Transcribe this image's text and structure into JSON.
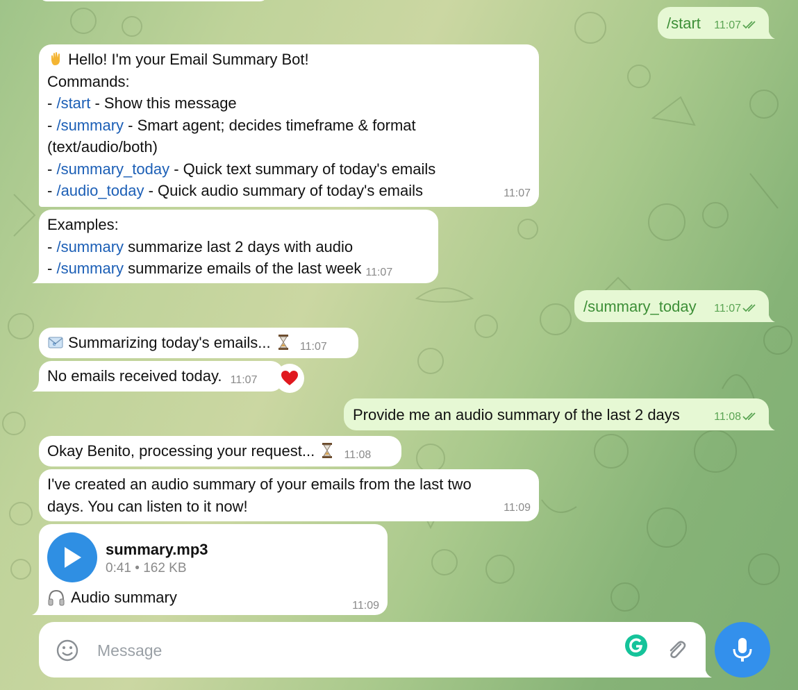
{
  "chat": {
    "messages": [
      {
        "id": "m1",
        "dir": "out",
        "text": "/start",
        "time": "11:07"
      },
      {
        "id": "m2",
        "dir": "in",
        "lines": [
          {
            "prefix": "",
            "emoji": "waving-hand",
            "text": "Hello! I'm your Email Summary Bot!"
          },
          {
            "prefix": "",
            "text": "Commands:"
          },
          {
            "prefix": "- ",
            "cmd": "/start",
            "text": " - Show this message"
          },
          {
            "prefix": "- ",
            "cmd": "/summary",
            "text": " - Smart agent; decides timeframe & format"
          },
          {
            "prefix": "",
            "text": "(text/audio/both)"
          },
          {
            "prefix": "- ",
            "cmd": "/summary_today",
            "text": " - Quick text summary of today's emails"
          },
          {
            "prefix": "- ",
            "cmd": "/audio_today",
            "text": " - Quick audio summary of today's emails"
          }
        ],
        "time": "11:07"
      },
      {
        "id": "m3",
        "dir": "in",
        "lines": [
          {
            "prefix": "",
            "text": "Examples:"
          },
          {
            "prefix": "- ",
            "cmd": "/summary",
            "text": " summarize last 2 days with audio"
          },
          {
            "prefix": "- ",
            "cmd": "/summary",
            "text": " summarize emails of the last week"
          }
        ],
        "time": "11:07"
      },
      {
        "id": "m4",
        "dir": "out",
        "text": "/summary_today",
        "time": "11:07"
      },
      {
        "id": "m5",
        "dir": "in",
        "emoji_start": "envelope",
        "text": "Summarizing today's emails...",
        "emoji_end": "hourglass",
        "time": "11:07"
      },
      {
        "id": "m6",
        "dir": "in",
        "text": "No emails received today.",
        "time": "11:07",
        "reaction": "heart"
      },
      {
        "id": "m7",
        "dir": "out",
        "text": "Provide me an audio summary of the last 2 days",
        "time": "11:08"
      },
      {
        "id": "m8",
        "dir": "in",
        "text": "Okay Benito, processing your request...",
        "emoji_end": "hourglass",
        "time": "11:08"
      },
      {
        "id": "m9",
        "dir": "in",
        "lines": [
          {
            "text": "I've created an audio summary of your emails from the last two"
          },
          {
            "text": "days. You can listen to it now!"
          }
        ],
        "time": "11:09"
      },
      {
        "id": "m10",
        "dir": "in",
        "type": "audio",
        "file_name": "summary.mp3",
        "duration": "0:41",
        "size": "162 KB",
        "caption": "Audio summary",
        "caption_icon": "headphones-icon",
        "time": "11:09"
      }
    ]
  },
  "composer": {
    "placeholder": "Message",
    "value": ""
  },
  "colors": {
    "outgoing_bubble": "#e6f8d4",
    "outgoing_text": "#3d8f37",
    "command_link": "#1c5fb6",
    "accent_blue": "#3390ec",
    "play_button": "#2f8fe3",
    "grammarly_green": "#15c39a"
  }
}
